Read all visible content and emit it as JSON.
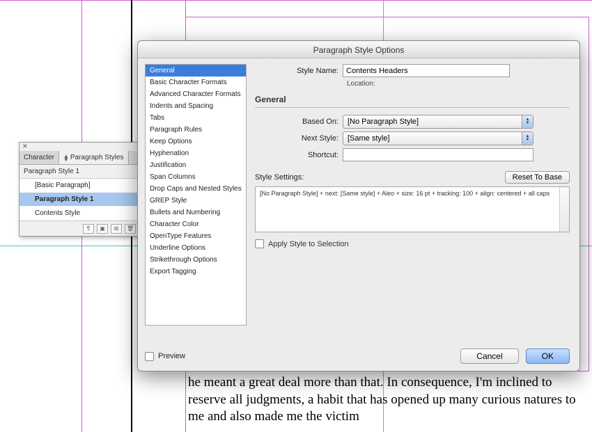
{
  "panel": {
    "tabs": {
      "character": "Character",
      "paragraph": "Paragraph Styles"
    },
    "current": "Paragraph Style 1",
    "items": [
      {
        "label": "[Basic Paragraph]"
      },
      {
        "label": "Paragraph Style 1"
      },
      {
        "label": "Contents Style"
      }
    ],
    "selected_index": 1
  },
  "dialog": {
    "title": "Paragraph Style Options",
    "categories": [
      "General",
      "Basic Character Formats",
      "Advanced Character Formats",
      "Indents and Spacing",
      "Tabs",
      "Paragraph Rules",
      "Keep Options",
      "Hyphenation",
      "Justification",
      "Span Columns",
      "Drop Caps and Nested Styles",
      "GREP Style",
      "Bullets and Numbering",
      "Character Color",
      "OpenType Features",
      "Underline Options",
      "Strikethrough Options",
      "Export Tagging"
    ],
    "selected_category_index": 0,
    "style_name_label": "Style Name:",
    "style_name_value": "Contents Headers",
    "location_label": "Location:",
    "section_title": "General",
    "based_on_label": "Based On:",
    "based_on_value": "[No Paragraph Style]",
    "next_style_label": "Next Style:",
    "next_style_value": "[Same style]",
    "shortcut_label": "Shortcut:",
    "shortcut_value": "",
    "style_settings_label": "Style Settings:",
    "reset_label": "Reset To Base",
    "settings_summary": "[No Paragraph Style] + next: [Same style] + Aleo + size: 16 pt + tracking: 100 + align: centered + all caps",
    "apply_label": "Apply Style to Selection",
    "preview_label": "Preview",
    "cancel_label": "Cancel",
    "ok_label": "OK"
  },
  "bg_text": "he meant a great deal more than that. In consequence, I'm inclined to reserve all judgments, a habit that has opened up many curious natures to me and also made me the victim"
}
